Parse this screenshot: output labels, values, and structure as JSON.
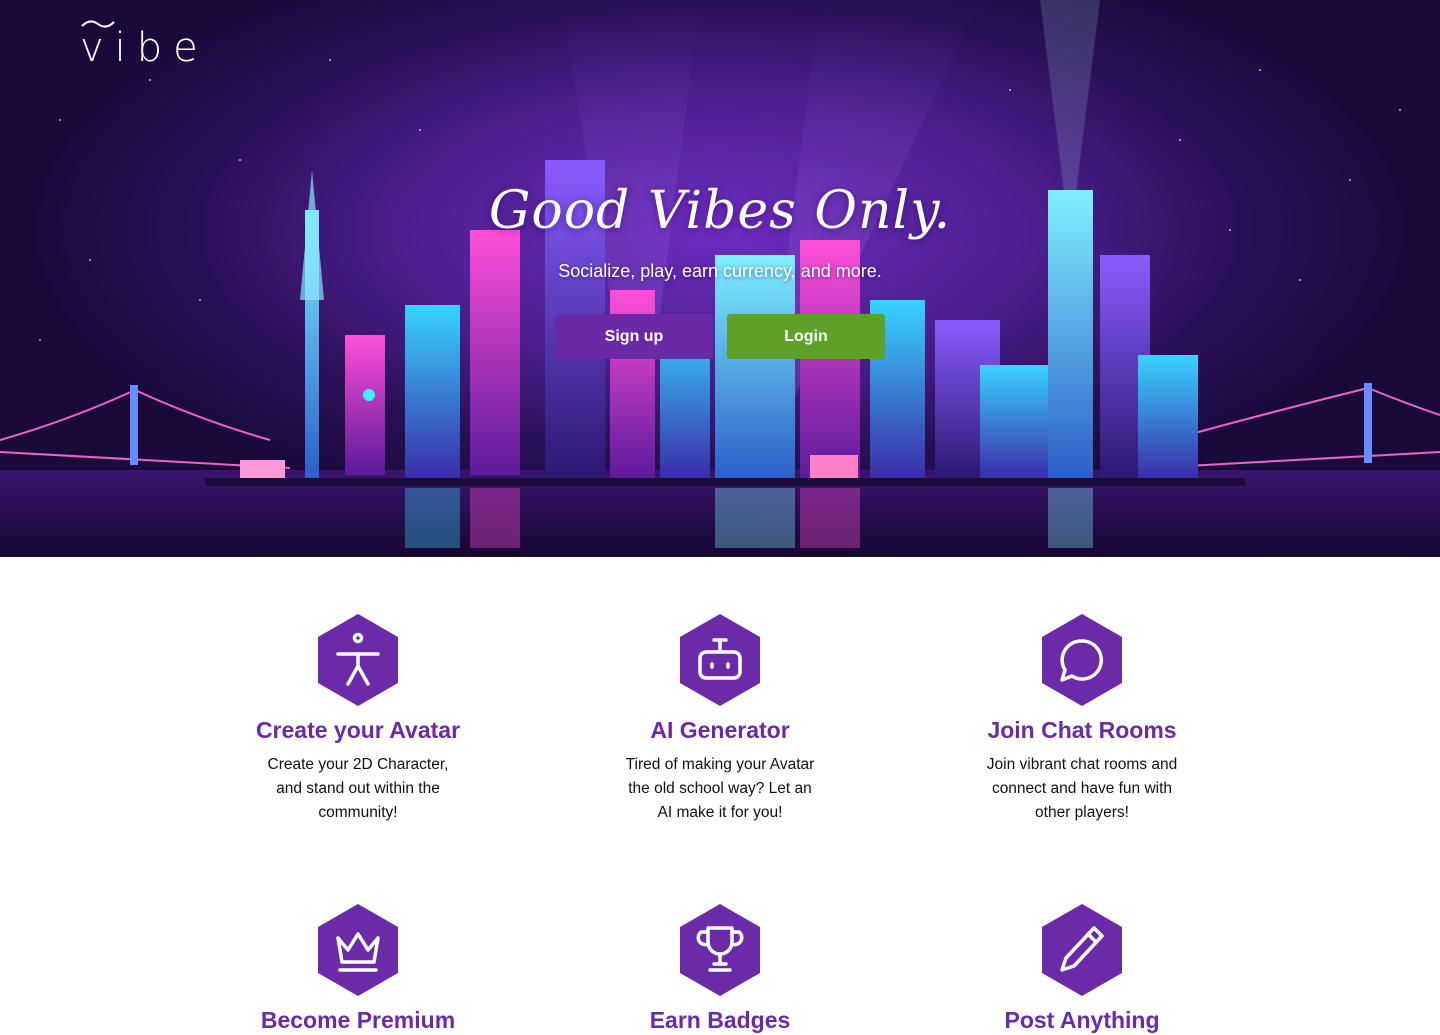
{
  "brand": {
    "logo_text": "vibe"
  },
  "hero": {
    "headline": "Good Vibes Only.",
    "subheadline": "Socialize, play, earn currency, and more.",
    "signup_label": "Sign up",
    "login_label": "Login"
  },
  "colors": {
    "accent_purple": "#6b2aa8",
    "signup_button": "#6a2aa6",
    "login_button": "#5da12b"
  },
  "features": [
    {
      "icon": "person-icon",
      "title": "Create your Avatar",
      "description": "Create your 2D Character, and stand out within the community!"
    },
    {
      "icon": "robot-icon",
      "title": "AI Generator",
      "description": "Tired of making your Avatar the old school way? Let an AI make it for you!"
    },
    {
      "icon": "chat-bubble-icon",
      "title": "Join Chat Rooms",
      "description": "Join vibrant chat rooms and connect and have fun with other players!"
    },
    {
      "icon": "crown-icon",
      "title": "Become Premium",
      "description": ""
    },
    {
      "icon": "trophy-icon",
      "title": "Earn Badges",
      "description": ""
    },
    {
      "icon": "pencil-icon",
      "title": "Post Anything",
      "description": ""
    }
  ]
}
